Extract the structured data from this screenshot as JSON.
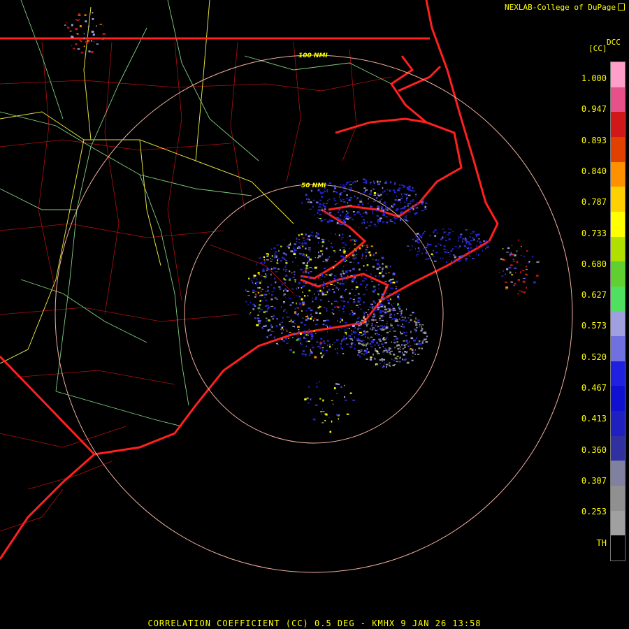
{
  "credit": {
    "text": "NEXLAB-College of DuPage",
    "icon": "cursor-arrow-icon"
  },
  "legend": {
    "title": "DCC",
    "unit": "[CC]",
    "labels": [
      "1.000",
      "0.947",
      "0.893",
      "0.840",
      "0.787",
      "0.733",
      "0.680",
      "0.627",
      "0.573",
      "0.520",
      "0.467",
      "0.413",
      "0.360",
      "0.307",
      "0.253",
      "TH"
    ],
    "colors": [
      "#ff9ec8",
      "#e8508a",
      "#d01818",
      "#e04000",
      "#ff9000",
      "#ffd000",
      "#ffff00",
      "#b0e000",
      "#60d030",
      "#50e060",
      "#a0a0e0",
      "#7070e0",
      "#2020e0",
      "#1010d0",
      "#2020c0",
      "#3030a0",
      "#8080a0",
      "#909090",
      "#a0a0a0",
      "#000000"
    ]
  },
  "range_rings": {
    "inner_label": "50 NMI",
    "outer_label": "100 NMI"
  },
  "footer": "CORRELATION COEFFICIENT (CC) 0.5 DEG - KMHX 9 JAN 26 13:58"
}
